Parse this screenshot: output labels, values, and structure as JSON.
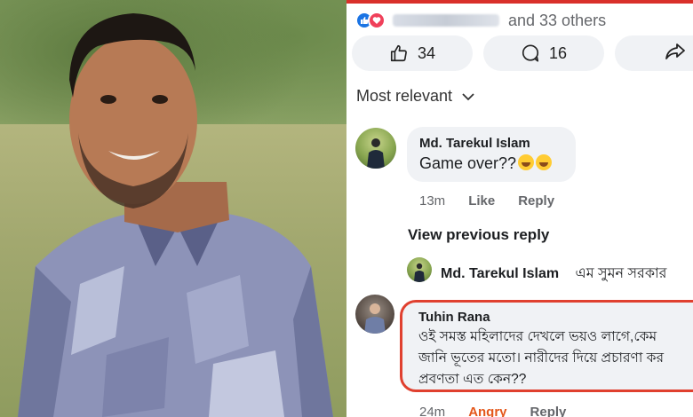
{
  "reactions": {
    "others_text": "and 33 others"
  },
  "actions": {
    "like_count": "34",
    "comment_count": "16"
  },
  "sort": {
    "label": "Most relevant"
  },
  "comments": [
    {
      "author": "Md. Tarekul Islam",
      "text": "Game over??",
      "time": "13m",
      "like_label": "Like",
      "reply_label": "Reply"
    },
    {
      "author": "Tuhin Rana",
      "line1": "ওই সমস্ত মহিলাদের দেখলে ভয়ও লাগে,কেম",
      "line2": "জানি ভূতের মতো। নারীদের দিয়ে প্রচারণা কর",
      "line3": "প্রবণতা এত কেন??",
      "time": "24m",
      "reaction_label": "Angry",
      "reply_label": "Reply"
    }
  ],
  "view_previous": "View previous reply",
  "reply_preview": {
    "author": "Md. Tarekul Islam",
    "text": "এম সুমন সরকার"
  },
  "colors": {
    "highlight_border": "#e0402f",
    "like_blue": "#1b74e4",
    "love_red": "#f0405a",
    "angry_orange": "#e4571a"
  }
}
